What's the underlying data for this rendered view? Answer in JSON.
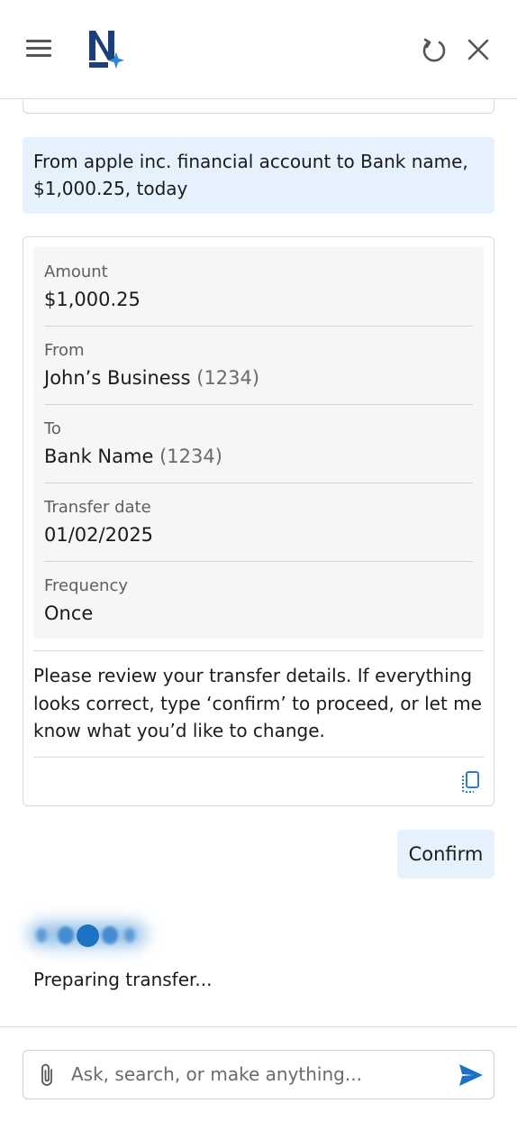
{
  "header": {
    "logo_name": "N",
    "icons": [
      "hamburger-menu-icon",
      "brand-logo",
      "refresh-icon",
      "close-icon"
    ]
  },
  "conversation": {
    "user_request": "From apple inc. financial account to Bank name, $1,000.25, today",
    "transfer_summary": {
      "fields": [
        {
          "label": "Amount",
          "value": "$1,000.25",
          "account": ""
        },
        {
          "label": "From",
          "value": "John’s Business",
          "account": "(1234)"
        },
        {
          "label": "To",
          "value": "Bank Name",
          "account": "(1234)"
        },
        {
          "label": "Transfer date",
          "value": "01/02/2025",
          "account": ""
        },
        {
          "label": "Frequency",
          "value": "Once",
          "account": ""
        }
      ],
      "review_message": "Please review your transfer details. If everything looks correct, type ‘confirm’ to proceed, or let me know what you’d like to change."
    },
    "user_confirm": "Confirm",
    "status_text": "Preparing transfer..."
  },
  "composer": {
    "placeholder": "Ask, search, or make anything...",
    "value": ""
  },
  "colors": {
    "brand_navy": "#1b3f7a",
    "brand_blue": "#1d72c4",
    "user_bubble": "#e5f1fc",
    "details_bg": "#f6f6f6"
  }
}
